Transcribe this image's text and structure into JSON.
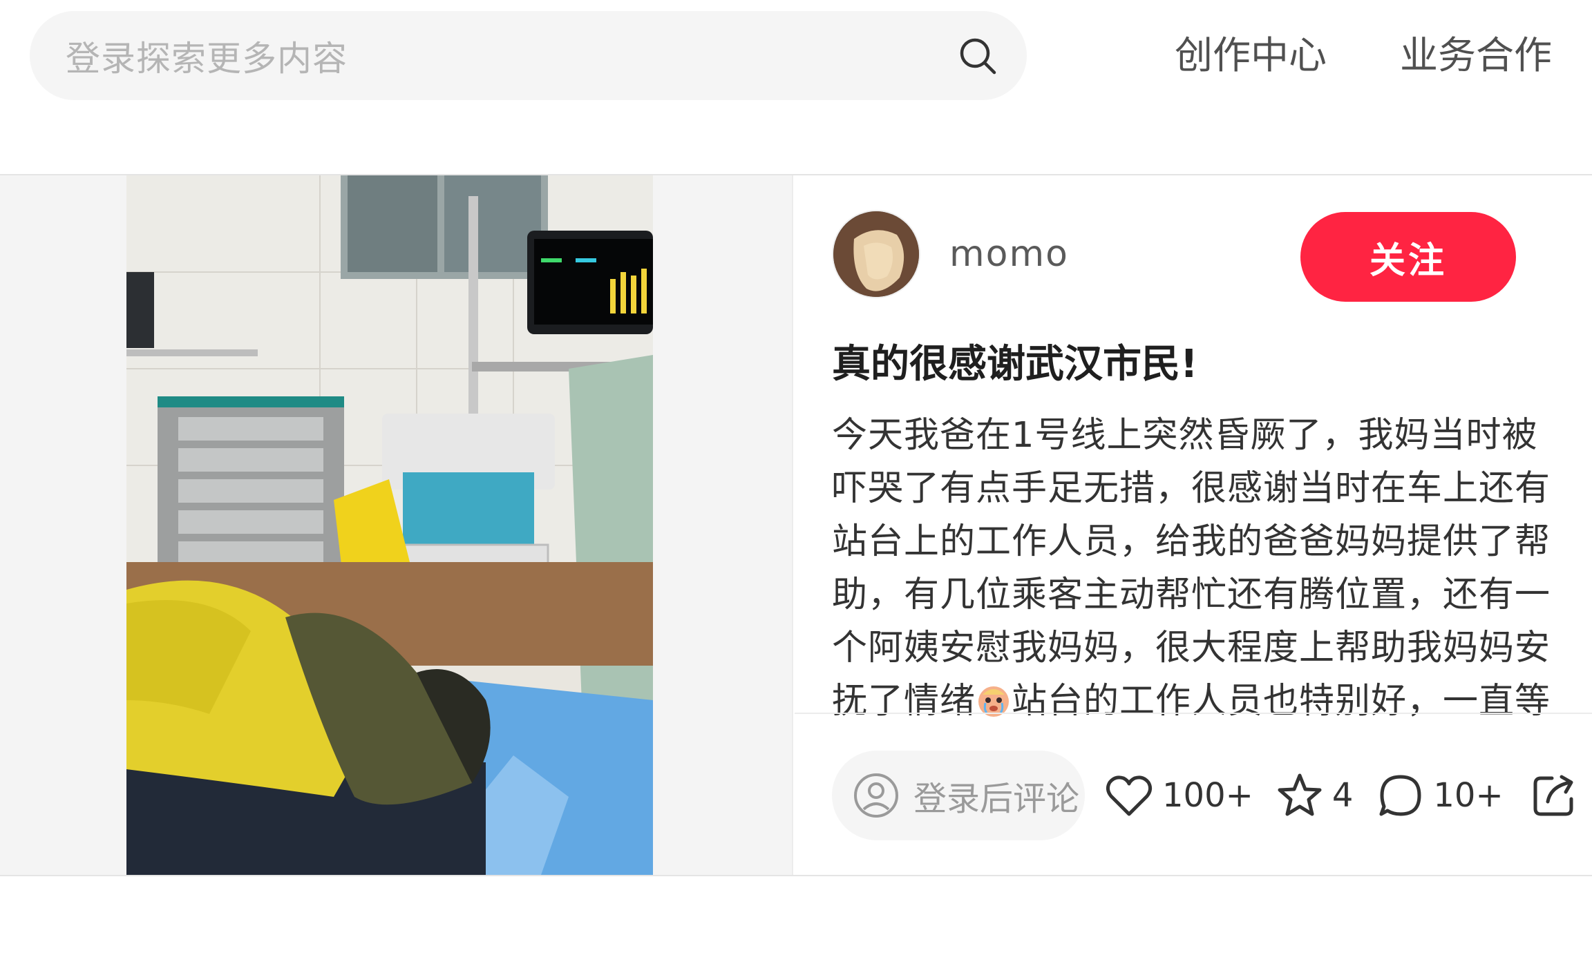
{
  "search": {
    "placeholder": "登录探索更多内容",
    "icon": "search-icon"
  },
  "nav": {
    "items": [
      {
        "label": "创作中心"
      },
      {
        "label": "业务合作"
      }
    ]
  },
  "note": {
    "author": {
      "name": "momo",
      "avatar_icon": "avatar"
    },
    "follow_label": "关注",
    "title": "真的很感谢武汉市民!",
    "body_part1": "今天我爸在1号线上突然昏厥了，我妈当时被吓哭了有点手足无措，很感谢当时在车上还有站台上的工作人员，给我的爸爸妈妈提供了帮助，有几位乘客主动帮忙还有腾位置，还有一个阿姨安慰我妈妈，很大程度上帮助我妈妈安抚了情绪",
    "body_emoji": "crying-emoji",
    "body_part2": "站台的工作人员也特别好，一直等",
    "actions": {
      "comment_placeholder": "登录后评论",
      "likes": "100+",
      "collects": "4",
      "comments": "10+"
    }
  },
  "colors": {
    "accent": "#ff2442",
    "search_bg": "#f5f5f5",
    "text_primary": "#333333",
    "placeholder": "#b5b5b5"
  }
}
